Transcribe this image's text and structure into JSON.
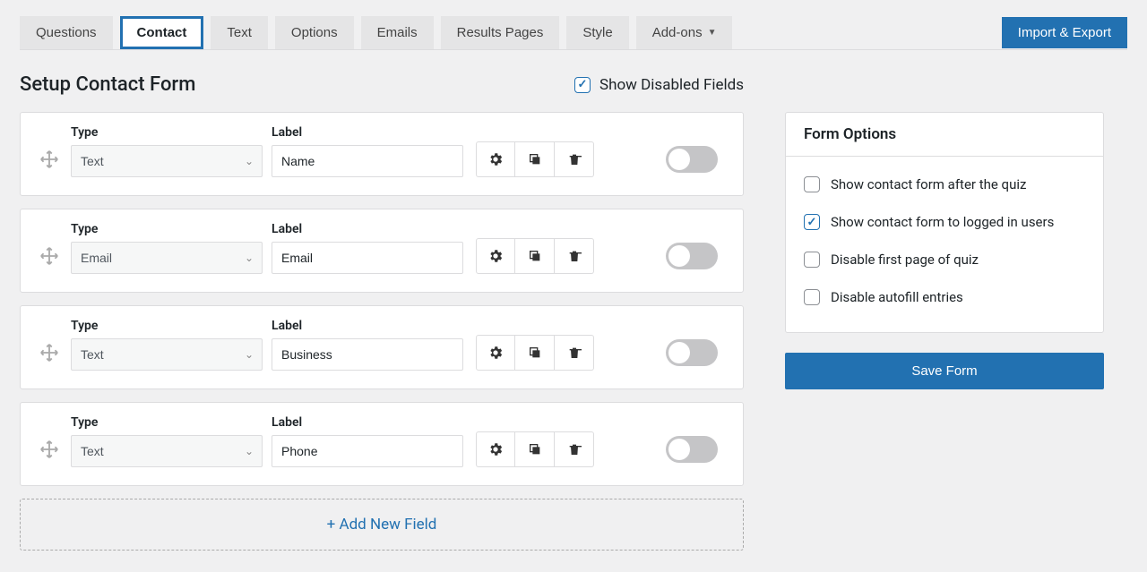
{
  "tabs": {
    "questions": "Questions",
    "contact": "Contact",
    "text": "Text",
    "options": "Options",
    "emails": "Emails",
    "results_pages": "Results Pages",
    "style": "Style",
    "addons": "Add-ons"
  },
  "import_export": "Import & Export",
  "heading": "Setup Contact Form",
  "show_disabled_label": "Show Disabled Fields",
  "show_disabled_checked": true,
  "field_header": {
    "type": "Type",
    "label": "Label"
  },
  "fields": [
    {
      "type": "Text",
      "label": "Name"
    },
    {
      "type": "Email",
      "label": "Email"
    },
    {
      "type": "Text",
      "label": "Business"
    },
    {
      "type": "Text",
      "label": "Phone"
    }
  ],
  "add_new": "+ Add New Field",
  "form_options": {
    "title": "Form Options",
    "items": [
      {
        "label": "Show contact form after the quiz",
        "checked": false
      },
      {
        "label": "Show contact form to logged in users",
        "checked": true
      },
      {
        "label": "Disable first page of quiz",
        "checked": false
      },
      {
        "label": "Disable autofill entries",
        "checked": false
      }
    ]
  },
  "save_form": "Save Form"
}
